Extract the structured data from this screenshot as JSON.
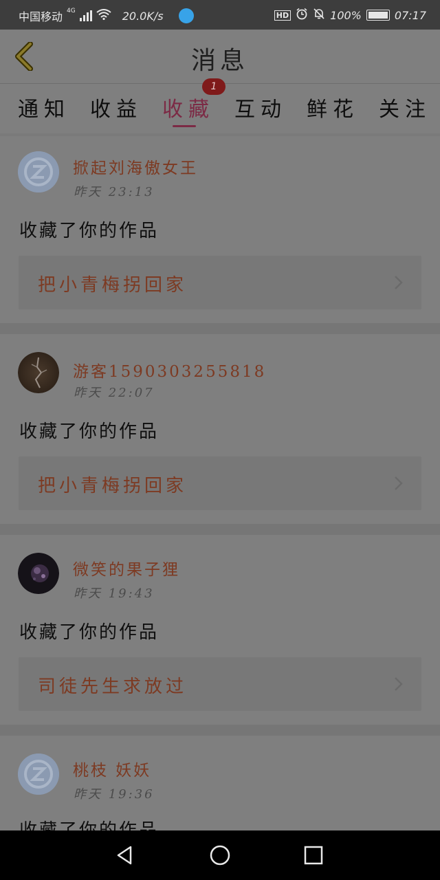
{
  "status_bar": {
    "carrier": "中国移动",
    "network": "4G",
    "speed": "20.0K/s",
    "hd": "HD",
    "battery": "100%",
    "time": "07:17"
  },
  "header": {
    "title": "消息"
  },
  "tabs": [
    {
      "label": "通知"
    },
    {
      "label": "收益"
    },
    {
      "label": "收藏",
      "active": true,
      "badge": "1"
    },
    {
      "label": "互动"
    },
    {
      "label": "鲜花"
    },
    {
      "label": "关注"
    }
  ],
  "items": [
    {
      "username": "掀起刘海傲女王",
      "time": "昨天 23:13",
      "action": "收藏了你的作品",
      "work_title": "把小青梅拐回家",
      "avatar": "default-avatar-icon"
    },
    {
      "username": "游客1590303255818",
      "time": "昨天 22:07",
      "action": "收藏了你的作品",
      "work_title": "把小青梅拐回家",
      "avatar": "photo-avatar"
    },
    {
      "username": "微笑的果子狸",
      "time": "昨天 19:43",
      "action": "收藏了你的作品",
      "work_title": "司徒先生求放过",
      "avatar": "photo-avatar"
    },
    {
      "username": "桃枝 妖妖",
      "time": "昨天 19:36",
      "action": "收藏了你的作品",
      "avatar": "default-avatar-icon"
    }
  ],
  "colors": {
    "accent": "#7c2a45",
    "name": "#7d3a22",
    "background": "#7f7f7f"
  }
}
